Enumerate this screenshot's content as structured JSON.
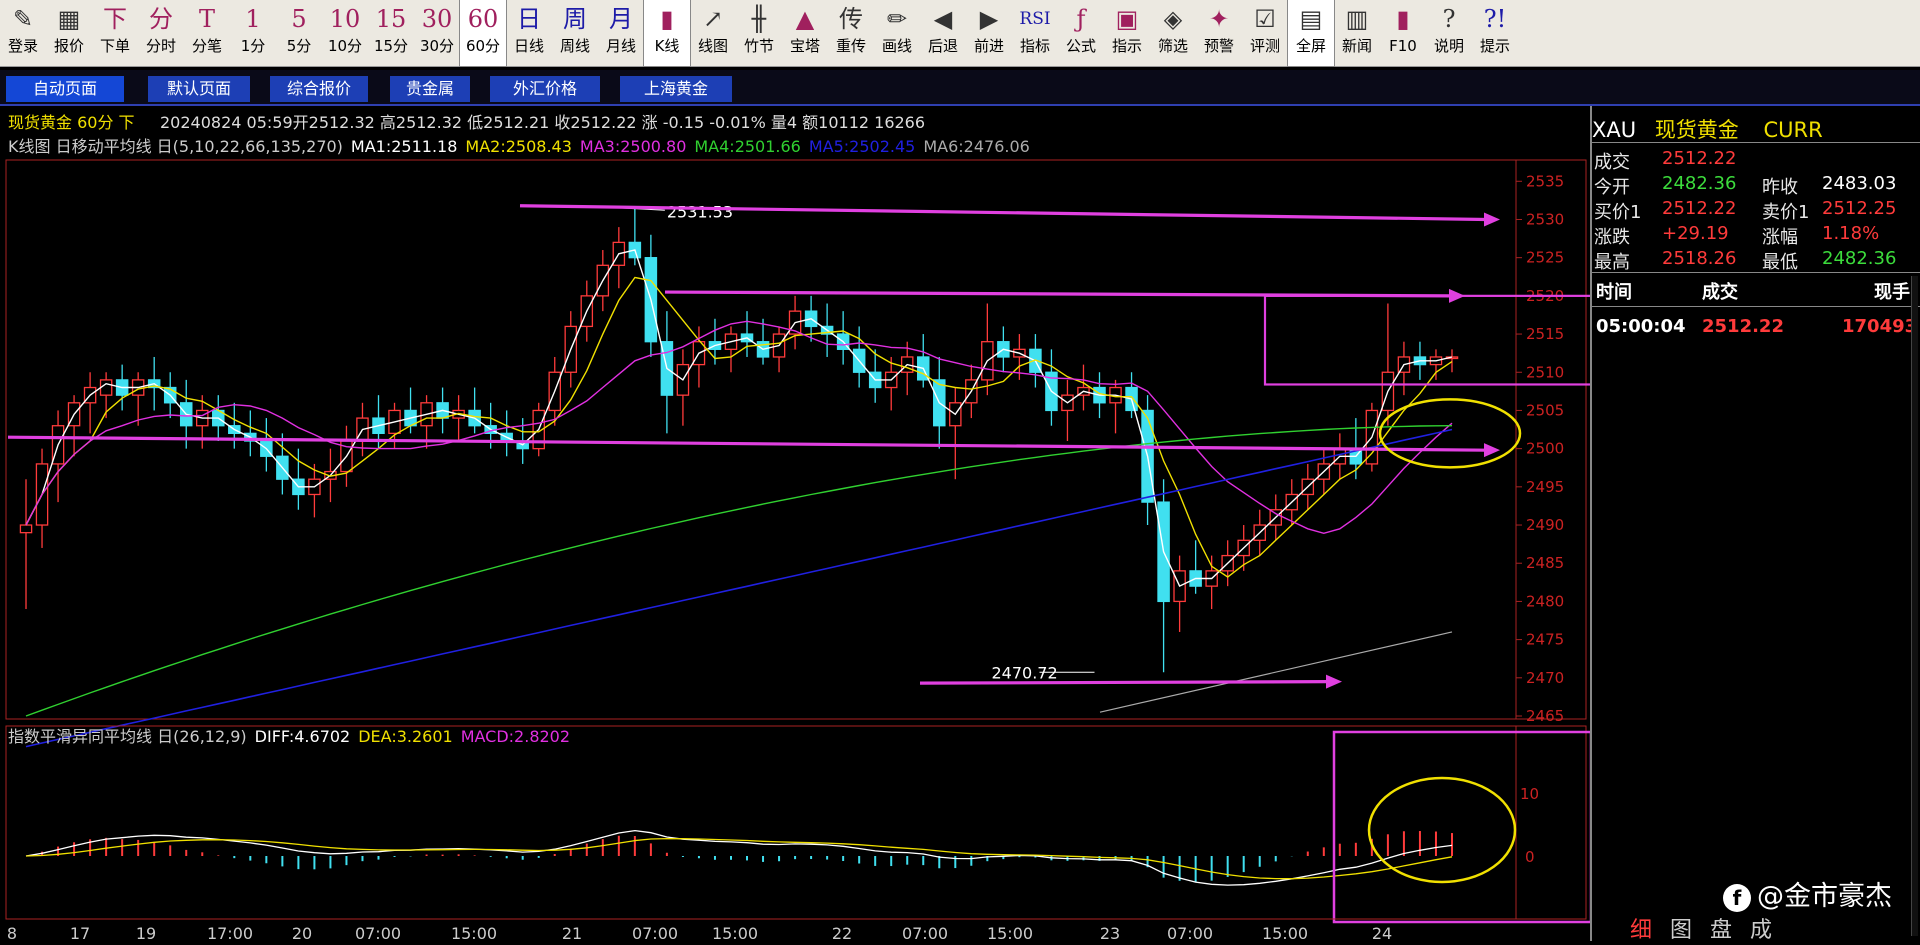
{
  "toolbar": [
    {
      "icon": "✎",
      "label": "登录",
      "name": "login",
      "cls": "dark"
    },
    {
      "icon": "▦",
      "label": "报价",
      "name": "quote",
      "cls": "dark"
    },
    {
      "icon": "下",
      "label": "下单",
      "name": "order",
      "cls": ""
    },
    {
      "icon": "分",
      "label": "分时",
      "name": "timeshare",
      "cls": ""
    },
    {
      "icon": "T",
      "label": "分笔",
      "name": "tick",
      "cls": ""
    },
    {
      "icon": "1",
      "label": "1分",
      "name": "min1",
      "cls": ""
    },
    {
      "icon": "5",
      "label": "5分",
      "name": "min5",
      "cls": ""
    },
    {
      "icon": "10",
      "label": "10分",
      "name": "min10",
      "cls": ""
    },
    {
      "icon": "15",
      "label": "15分",
      "name": "min15",
      "cls": ""
    },
    {
      "icon": "30",
      "label": "30分",
      "name": "min30",
      "cls": ""
    },
    {
      "icon": "60",
      "label": "60分",
      "name": "min60",
      "cls": "",
      "active": true
    },
    {
      "icon": "日",
      "label": "日线",
      "name": "daily",
      "cls": "blue"
    },
    {
      "icon": "周",
      "label": "周线",
      "name": "weekly",
      "cls": "blue"
    },
    {
      "icon": "月",
      "label": "月线",
      "name": "monthly",
      "cls": "blue"
    },
    {
      "icon": "▮",
      "label": "K线",
      "name": "kline",
      "cls": "",
      "active": true
    },
    {
      "icon": "↗",
      "label": "线图",
      "name": "linechart",
      "cls": "dark"
    },
    {
      "icon": "╫",
      "label": "竹节",
      "name": "bamboo",
      "cls": "dark"
    },
    {
      "icon": "▲",
      "label": "宝塔",
      "name": "tower",
      "cls": ""
    },
    {
      "icon": "传",
      "label": "重传",
      "name": "reload",
      "cls": "dark"
    },
    {
      "icon": "✏",
      "label": "画线",
      "name": "draw",
      "cls": "dark"
    },
    {
      "icon": "◀",
      "label": "后退",
      "name": "back",
      "cls": "dark"
    },
    {
      "icon": "▶",
      "label": "前进",
      "name": "forward",
      "cls": "dark"
    },
    {
      "icon": "RSI",
      "label": "指标",
      "name": "indicator",
      "cls": "blue"
    },
    {
      "icon": "ƒ",
      "label": "公式",
      "name": "formula",
      "cls": ""
    },
    {
      "icon": "▣",
      "label": "指示",
      "name": "signal",
      "cls": ""
    },
    {
      "icon": "◈",
      "label": "筛选",
      "name": "filter",
      "cls": "dark"
    },
    {
      "icon": "✦",
      "label": "预警",
      "name": "alert",
      "cls": ""
    },
    {
      "icon": "☑",
      "label": "评测",
      "name": "review",
      "cls": "dark"
    },
    {
      "icon": "▤",
      "label": "全屏",
      "name": "fullscreen",
      "cls": "dark",
      "active": true
    },
    {
      "icon": "▥",
      "label": "新闻",
      "name": "news",
      "cls": "dark"
    },
    {
      "icon": "▮",
      "label": "F10",
      "name": "f10",
      "cls": ""
    },
    {
      "icon": "?",
      "label": "说明",
      "name": "help",
      "cls": "dark"
    },
    {
      "icon": "?!",
      "label": "提示",
      "name": "tips",
      "cls": "blue"
    }
  ],
  "tabs": [
    {
      "label": "自动页面",
      "on": true
    },
    {
      "label": "默认页面"
    },
    {
      "label": "综合报价"
    },
    {
      "label": "贵金属"
    },
    {
      "label": "外汇价格"
    },
    {
      "label": "上海黄金"
    }
  ],
  "header": {
    "title": "现货黄金 60分 下",
    "info": "20240824 05:59开2512.32 高2512.32 低2512.21 收2512.22 涨 -0.15 -0.01% 量4 额10112 16266"
  },
  "ma_legend": {
    "prefix": "K线图 日移动平均线 日(5,10,22,66,135,270)",
    "items": [
      {
        "text": "MA1:2511.18",
        "color": "#ffffff"
      },
      {
        "text": "MA2:2508.43",
        "color": "#f0e000"
      },
      {
        "text": "MA3:2500.80",
        "color": "#e030e0"
      },
      {
        "text": "MA4:2501.66",
        "color": "#30d030"
      },
      {
        "text": "MA5:2502.45",
        "color": "#2020e0"
      },
      {
        "text": "MA6:2476.06",
        "color": "#aaaaaa"
      }
    ]
  },
  "macd_legend": {
    "prefix": "指数平滑异同平均线 日(26,12,9)",
    "items": [
      {
        "text": "DIFF:4.6702",
        "color": "#ffffff"
      },
      {
        "text": "DEA:3.2601",
        "color": "#f0e000"
      },
      {
        "text": "MACD:2.8202",
        "color": "#e030e0"
      }
    ]
  },
  "annotations": {
    "high": "2531.53",
    "low": "2470.72"
  },
  "chart_data": {
    "type": "candlestick",
    "ylim": [
      2465,
      2537
    ],
    "y_ticks": [
      2535,
      2530,
      2525,
      2520,
      2515,
      2510,
      2505,
      2500,
      2495,
      2490,
      2485,
      2480,
      2475,
      2470,
      2465
    ],
    "macd_ticks": [
      "10",
      "0"
    ],
    "x_labels": [
      "8",
      "17",
      "19",
      "17:00",
      "20",
      "07:00",
      "15:00",
      "21",
      "07:00",
      "15:00",
      "22",
      "07:00",
      "15:00",
      "23",
      "07:00",
      "15:00",
      "24"
    ],
    "candles": [
      [
        2489,
        2496,
        2479,
        2490
      ],
      [
        2490,
        2500,
        2487,
        2498
      ],
      [
        2498,
        2505,
        2493,
        2503
      ],
      [
        2503,
        2507,
        2499,
        2506
      ],
      [
        2506,
        2510,
        2502,
        2508
      ],
      [
        2507,
        2510,
        2504,
        2509
      ],
      [
        2509,
        2511,
        2505,
        2507
      ],
      [
        2507,
        2510,
        2503,
        2509
      ],
      [
        2509,
        2512,
        2505,
        2508
      ],
      [
        2508,
        2510,
        2504,
        2506
      ],
      [
        2506,
        2509,
        2500,
        2503
      ],
      [
        2503,
        2507,
        2500,
        2505
      ],
      [
        2505,
        2507,
        2501,
        2503
      ],
      [
        2503,
        2506,
        2500,
        2502
      ],
      [
        2502,
        2505,
        2499,
        2501
      ],
      [
        2501,
        2504,
        2497,
        2499
      ],
      [
        2499,
        2502,
        2494,
        2496
      ],
      [
        2496,
        2500,
        2492,
        2494
      ],
      [
        2494,
        2498,
        2491,
        2496
      ],
      [
        2496,
        2500,
        2493,
        2497
      ],
      [
        2497,
        2503,
        2495,
        2501
      ],
      [
        2501,
        2506,
        2499,
        2504
      ],
      [
        2504,
        2507,
        2500,
        2502
      ],
      [
        2502,
        2506,
        2500,
        2505
      ],
      [
        2505,
        2508,
        2502,
        2503
      ],
      [
        2503,
        2507,
        2500,
        2506
      ],
      [
        2506,
        2508,
        2502,
        2504
      ],
      [
        2504,
        2507,
        2501,
        2505
      ],
      [
        2505,
        2508,
        2502,
        2503
      ],
      [
        2503,
        2506,
        2500,
        2502
      ],
      [
        2502,
        2505,
        2499,
        2501
      ],
      [
        2501,
        2504,
        2498,
        2500
      ],
      [
        2500,
        2506,
        2499,
        2505
      ],
      [
        2505,
        2512,
        2503,
        2510
      ],
      [
        2510,
        2518,
        2508,
        2516
      ],
      [
        2516,
        2522,
        2514,
        2520
      ],
      [
        2520,
        2526,
        2518,
        2524
      ],
      [
        2524,
        2529,
        2521,
        2527
      ],
      [
        2527,
        2531.53,
        2524,
        2525
      ],
      [
        2525,
        2528,
        2512,
        2514
      ],
      [
        2514,
        2518,
        2502,
        2507
      ],
      [
        2507,
        2513,
        2503,
        2511
      ],
      [
        2511,
        2516,
        2508,
        2514
      ],
      [
        2514,
        2517,
        2511,
        2513
      ],
      [
        2513,
        2516,
        2510,
        2515
      ],
      [
        2515,
        2518,
        2512,
        2514
      ],
      [
        2514,
        2517,
        2511,
        2512
      ],
      [
        2512,
        2516,
        2510,
        2515
      ],
      [
        2515,
        2520,
        2513,
        2518
      ],
      [
        2518,
        2520,
        2514,
        2516
      ],
      [
        2516,
        2519,
        2512,
        2515
      ],
      [
        2515,
        2518,
        2511,
        2513
      ],
      [
        2513,
        2516,
        2508,
        2510
      ],
      [
        2510,
        2513,
        2506,
        2508
      ],
      [
        2508,
        2512,
        2505,
        2510
      ],
      [
        2510,
        2514,
        2507,
        2512
      ],
      [
        2512,
        2515,
        2508,
        2509
      ],
      [
        2509,
        2512,
        2500,
        2503
      ],
      [
        2503,
        2508,
        2496,
        2506
      ],
      [
        2506,
        2511,
        2504,
        2509
      ],
      [
        2509,
        2519,
        2507,
        2514
      ],
      [
        2514,
        2516,
        2510,
        2512
      ],
      [
        2512,
        2515,
        2509,
        2513
      ],
      [
        2513,
        2515,
        2508,
        2510
      ],
      [
        2510,
        2513,
        2503,
        2505
      ],
      [
        2505,
        2509,
        2501,
        2507
      ],
      [
        2507,
        2511,
        2505,
        2508
      ],
      [
        2508,
        2510,
        2504,
        2506
      ],
      [
        2506,
        2509,
        2502,
        2508
      ],
      [
        2508,
        2510,
        2504,
        2505
      ],
      [
        2505,
        2507,
        2490,
        2493
      ],
      [
        2493,
        2496,
        2470.72,
        2480
      ],
      [
        2480,
        2486,
        2476,
        2484
      ],
      [
        2484,
        2488,
        2481,
        2482
      ],
      [
        2482,
        2486,
        2479,
        2484
      ],
      [
        2484,
        2488,
        2482,
        2486
      ],
      [
        2486,
        2490,
        2484,
        2488
      ],
      [
        2488,
        2492,
        2486,
        2490
      ],
      [
        2490,
        2494,
        2488,
        2492
      ],
      [
        2492,
        2496,
        2490,
        2494
      ],
      [
        2494,
        2498,
        2492,
        2496
      ],
      [
        2496,
        2500,
        2494,
        2498
      ],
      [
        2498,
        2502,
        2496,
        2500
      ],
      [
        2500,
        2504,
        2496,
        2498
      ],
      [
        2498,
        2506,
        2497,
        2505
      ],
      [
        2505,
        2519,
        2503,
        2510
      ],
      [
        2510,
        2514,
        2507,
        2512
      ],
      [
        2512,
        2514,
        2509,
        2511
      ],
      [
        2511,
        2513,
        2509,
        2512
      ],
      [
        2512,
        2513,
        2510,
        2512
      ]
    ]
  },
  "info_panel": {
    "symbol": "XAU",
    "name": "现货黄金",
    "curr": "CURR",
    "rows": [
      {
        "l1": "成交",
        "v1": "2512.22",
        "c1": "red"
      },
      {
        "l1": "今开",
        "v1": "2482.36",
        "c1": "green",
        "l2": "昨收",
        "v2": "2483.03",
        "c2": "white"
      },
      {
        "l1": "买价1",
        "v1": "2512.22",
        "c1": "red",
        "l2": "卖价1",
        "v2": "2512.25",
        "c2": "red"
      },
      {
        "l1": "涨跌",
        "v1": "+29.19",
        "c1": "red",
        "l2": "涨幅",
        "v2": "1.18%",
        "c2": "red"
      },
      {
        "l1": "最高",
        "v1": "2518.26",
        "c1": "red",
        "l2": "最低",
        "v2": "2482.36",
        "c2": "green"
      }
    ],
    "trade_header": [
      "时间",
      "成交",
      "现手"
    ],
    "trade": {
      "time": "05:00:04",
      "price": "2512.22",
      "vol": "170493"
    }
  },
  "bottom_tabs": [
    "细",
    "图",
    "盘",
    "成"
  ],
  "watermark": "@金市豪杰"
}
